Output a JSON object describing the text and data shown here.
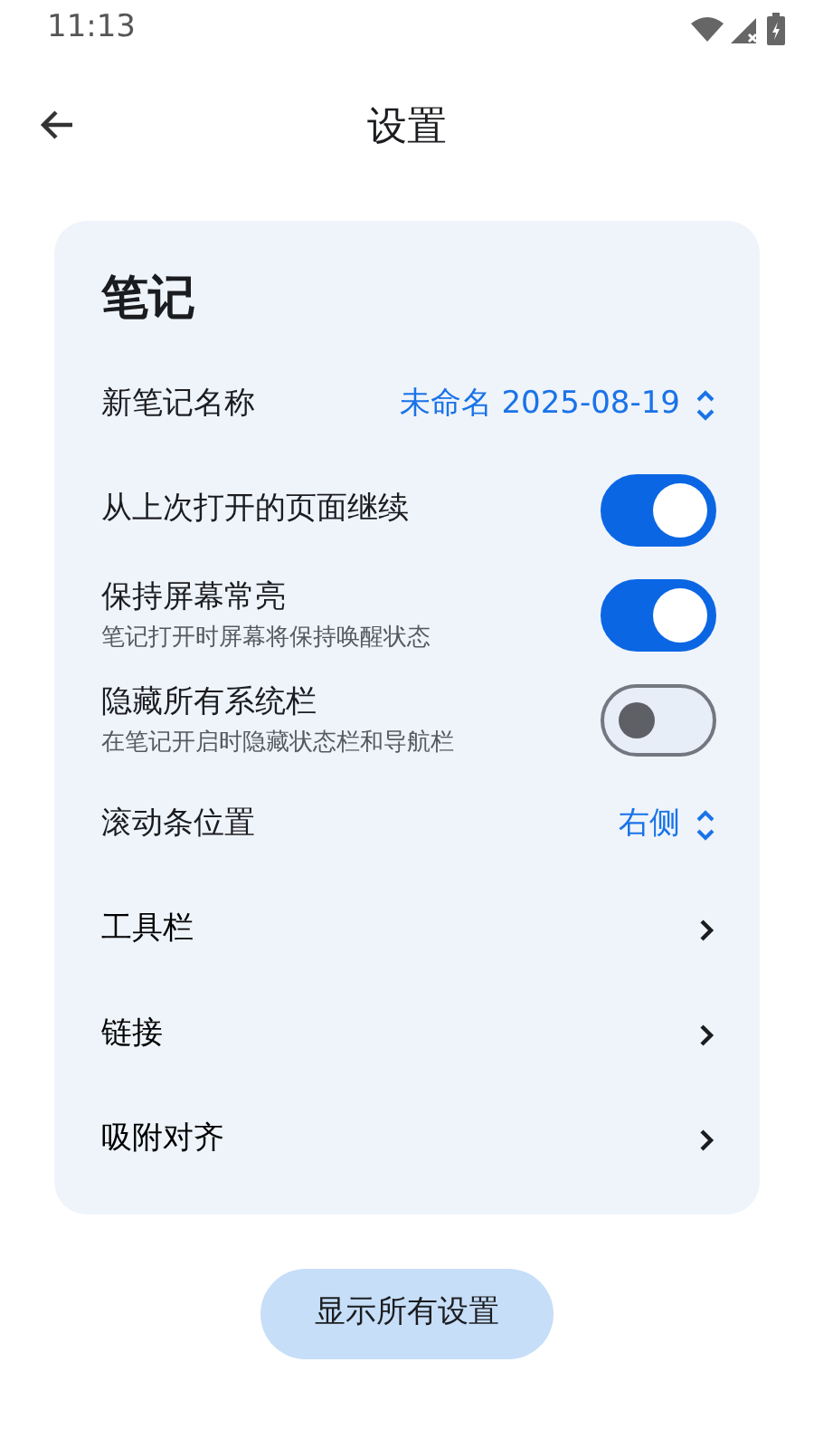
{
  "status_bar": {
    "time": "11:13"
  },
  "app_bar": {
    "title": "设置"
  },
  "section": {
    "title": "笔记",
    "items": [
      {
        "kind": "select",
        "label": "新笔记名称",
        "value": "未命名 2025-08-19"
      },
      {
        "kind": "toggle",
        "label": "从上次打开的页面继续",
        "on": true
      },
      {
        "kind": "toggle",
        "label": "保持屏幕常亮",
        "description": "笔记打开时屏幕将保持唤醒状态",
        "on": true
      },
      {
        "kind": "toggle",
        "label": "隐藏所有系统栏",
        "description": "在笔记开启时隐藏状态栏和导航栏",
        "on": false
      },
      {
        "kind": "select",
        "label": "滚动条位置",
        "value": "右侧"
      },
      {
        "kind": "link",
        "label": "工具栏"
      },
      {
        "kind": "link",
        "label": "链接"
      },
      {
        "kind": "link",
        "label": "吸附对齐"
      }
    ]
  },
  "button": "显示所有设置"
}
